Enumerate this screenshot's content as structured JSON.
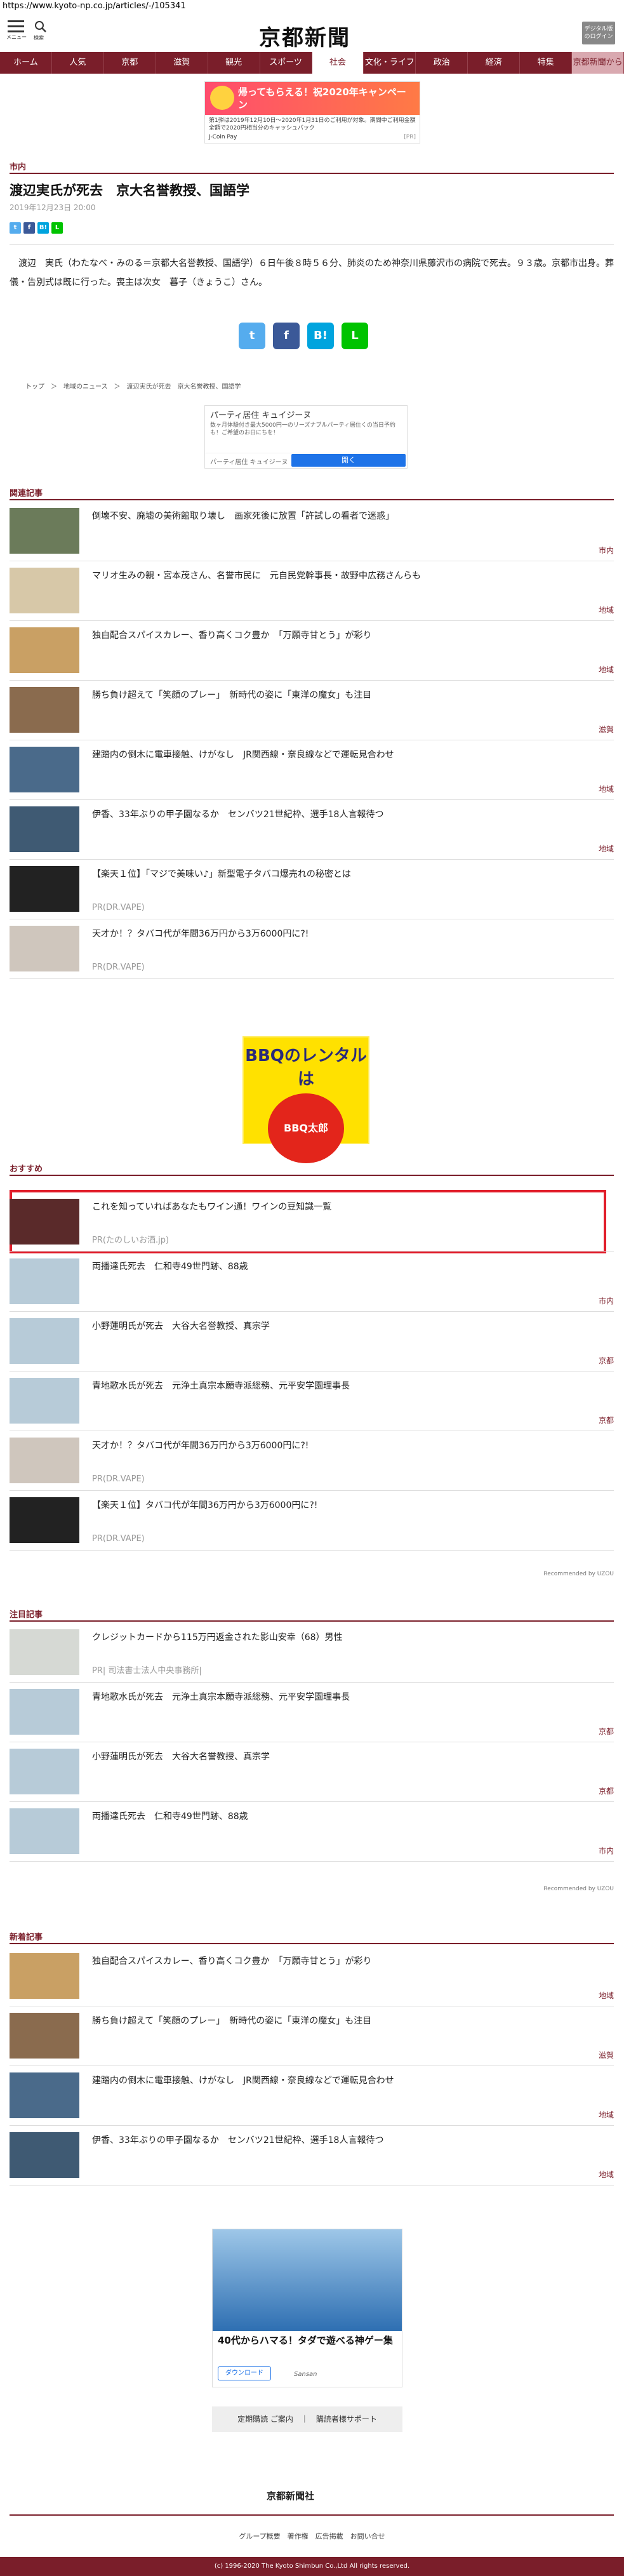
{
  "browser": {
    "url": "https://www.kyoto-np.co.jp/articles/-/105341"
  },
  "header": {
    "menu_label": "メニュー",
    "search_label": "検索",
    "logo": "京都新聞",
    "digital_button": "デジタル版\nのログイン"
  },
  "nav": [
    "ホーム",
    "人気",
    "京都",
    "滋賀",
    "観光",
    "スポーツ",
    "社会",
    "文化・ライフ",
    "政治",
    "経済",
    "特集",
    "京都新聞から"
  ],
  "ad_top": {
    "banner": "帰ってもらえる！祝2020年キャンペーン",
    "small": "第1弾は2019年12月10日〜2020年1月31日のご利用が対象。期間中ご利用金額全額で2020円相当分のキャッシュバック",
    "brand": "J-Coin Pay",
    "pr": "[PR]"
  },
  "article": {
    "category": "市内",
    "title": "渡辺実氏が死去　京大名誉教授、国語学",
    "date": "2019年12月23日 20:00",
    "body": "渡辺　実氏（わたなべ・みのる＝京都大名誉教授、国語学）６日午後８時５６分、肺炎のため神奈川県藤沢市の病院で死去。９３歳。京都市出身。葬儀・告別式は既に行った。喪主は次女　暮子（きょうこ）さん。"
  },
  "share_small": [
    "t",
    "f",
    "B!",
    "L"
  ],
  "share_big": [
    "t",
    "f",
    "B!",
    "L"
  ],
  "breadcrumb": "トップ　＞　地域のニュース　＞　渡辺実氏が死去　京大名誉教授、国語学",
  "ad_mid": {
    "title": "パーティ居住 キュイジーヌ",
    "sub": "数ヶ月体験付き最大5000円一のリーズナブルパーティ居住くの当日予約も！ご希望のお日にちを！",
    "bar_label": "パーティ居住 キュイジーヌ",
    "open": "開く"
  },
  "related": {
    "heading": "関連記事",
    "items": [
      {
        "title": "倒壊不安、廃墟の美術館取り壊し　画家死後に放置「許試しの看者で迷惑」",
        "tag": "市内"
      },
      {
        "title": "マリオ生みの親・宮本茂さん、名誉市民に　元自民党幹事長・故野中広務さんらも",
        "tag": "地域"
      },
      {
        "title": "独自配合スパイスカレー、香り高くコク豊か　「万願寺甘とう」が彩り",
        "tag": "地域"
      },
      {
        "title": "勝ち負け超えて「笑顔のプレー」　新時代の姿に「東洋の魔女」も注目",
        "tag": "滋賀"
      },
      {
        "title": "建踏内の倒木に電車接触、けがなし　JR関西線・奈良線などで運転見合わせ",
        "tag": "地域"
      },
      {
        "title": "伊香、33年ぶりの甲子園なるか　センバツ21世紀枠、選手18人言報待つ",
        "tag": "地域"
      },
      {
        "title": "【楽天１位】「マジで美味い♪」新型電子タバコ爆売れの秘密とは",
        "pr": "PR(DR.VAPE)"
      },
      {
        "title": "天才か！？タバコ代が年間36万円から3万6000円に?!",
        "pr": "PR(DR.VAPE)"
      }
    ]
  },
  "bbq_ad": {
    "line1": "BBQのレンタルは",
    "line2": "BBQ太郎"
  },
  "recommend": {
    "heading": "おすすめ",
    "items": [
      {
        "title": "これを知っていればあなたもワイン通！ワインの豆知識一覧",
        "pr": "PR(たのしいお酒.jp)"
      },
      {
        "title": "両播達氏死去　仁和寺49世門跡、88歳",
        "tag": "市内"
      },
      {
        "title": "小野蓮明氏が死去　大谷大名誉教授、真宗学",
        "tag": "京都"
      },
      {
        "title": "青地歌水氏が死去　元浄土真宗本願寺派総務、元平安学園理事長",
        "tag": "京都"
      },
      {
        "title": "天才か！？タバコ代が年間36万円から3万6000円に?!",
        "pr": "PR(DR.VAPE)"
      },
      {
        "title": "【楽天１位】タバコ代が年間36万円から3万6000円に?!",
        "pr": "PR(DR.VAPE)"
      }
    ],
    "by": "Recommended by UZOU"
  },
  "attention": {
    "heading": "注目記事",
    "items": [
      {
        "title": "クレジットカードから115万円返金された影山安幸（68）男性",
        "pr": "PR| 司法書士法人中央事務所|"
      },
      {
        "title": "青地歌水氏が死去　元浄土真宗本願寺派総務、元平安学園理事長",
        "tag": "京都"
      },
      {
        "title": "小野蓮明氏が死去　大谷大名誉教授、真宗学",
        "tag": "京都"
      },
      {
        "title": "両播達氏死去　仁和寺49世門跡、88歳",
        "tag": "市内"
      }
    ],
    "by": "Recommended by UZOU"
  },
  "latest": {
    "heading": "新着記事",
    "items": [
      {
        "title": "独自配合スパイスカレー、香り高くコク豊か　「万願寺甘とう」が彩り",
        "tag": "地域"
      },
      {
        "title": "勝ち負け超えて「笑顔のプレー」　新時代の姿に「東洋の魔女」も注目",
        "tag": "滋賀"
      },
      {
        "title": "建踏内の倒木に電車接触、けがなし　JR関西線・奈良線などで運転見合わせ",
        "tag": "地域"
      },
      {
        "title": "伊香、33年ぶりの甲子園なるか　センバツ21世紀枠、選手18人言報待つ",
        "tag": "地域"
      }
    ]
  },
  "map_ad": {
    "title": "40代からハマる！タダで遊べる神ゲー集",
    "button": "ダウンロード",
    "brand": "Sansan"
  },
  "footer_links": "定期購読 ご案内　｜　購読者様サポート",
  "footer_logo": "京都新聞社",
  "footer_nav": "グループ概要　著作権　広告掲載　お問い合せ",
  "copyright": "(c) 1996-2020 The Kyoto Shimbun Co.,Ltd All rights reserved."
}
